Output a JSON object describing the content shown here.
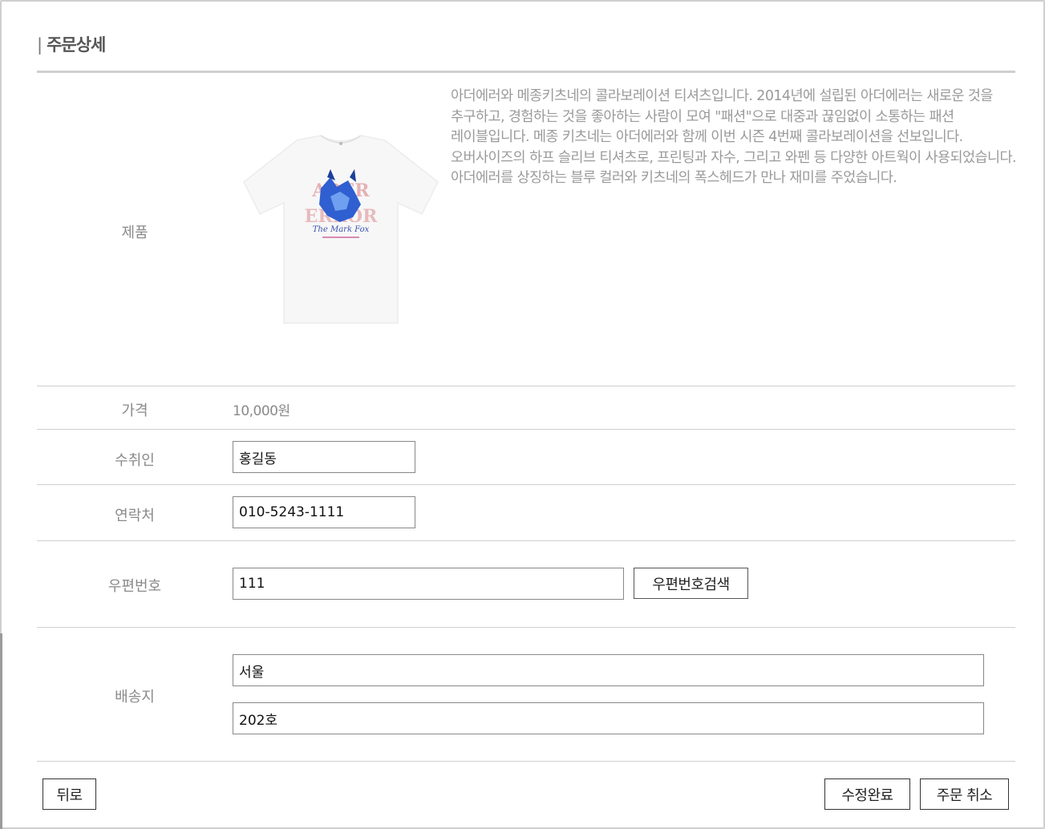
{
  "page": {
    "title": "주문상세",
    "title_bar": "|"
  },
  "labels": {
    "product": "제품",
    "price": "가격",
    "recipient": "수취인",
    "phone": "연락처",
    "zipcode": "우편번호",
    "address": "배송지"
  },
  "product": {
    "description": "아더에러와 메종키츠네의 콜라보레이션 티셔츠입니다. 2014년에 설립된 아더에러는 새로운 것을 추구하고, 경험하는 것을 좋아하는 사람이 모여 \"패션\"으로 대중과 끊임없이 소통하는 패션 레이블입니다. 메종 키츠네는 아더에러와 함께 이번 시즌 4번째 콜라보레이션을 선보입니다. 오버사이즈의 하프 슬리브 티셔츠로, 프린팅과 자수, 그리고 와펜 등 다양한 아트웍이 사용되었습니다. 아더에러를 상징하는 블루 컬러와 키츠네의 폭스헤드가 만나 재미를 주었습니다.",
    "image_icon": "tshirt-icon",
    "print_text_top": "ADER",
    "print_text_bottom": "ERROR",
    "print_script": "The Mark Fox"
  },
  "price": {
    "value": "10,000원"
  },
  "form": {
    "recipient_value": "홍길동",
    "phone_value": "010-5243-1111",
    "zipcode_value": "111",
    "address1_value": "서울",
    "address2_value": "202호"
  },
  "buttons": {
    "zip_search": "우편번호검색",
    "back": "뒤로",
    "save": "수정완료",
    "cancel_order": "주문 취소"
  },
  "colors": {
    "accent_blue": "#2f5fd0",
    "border": "#cfcfcf",
    "label_text": "#8a8a8a"
  }
}
